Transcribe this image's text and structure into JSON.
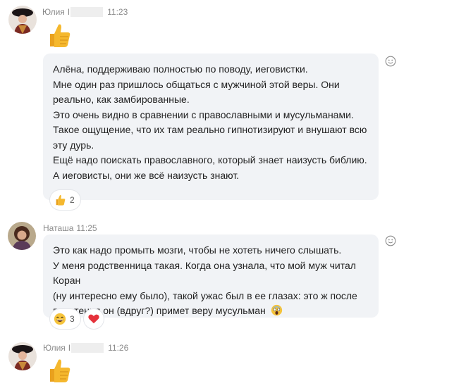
{
  "messages": [
    {
      "author": "Юлия",
      "author_suffix": "I",
      "time": "11:23",
      "content_type": "thumbs-up-emoji"
    },
    {
      "author": "Юлия",
      "lines": [
        "Алёна, поддерживаю полностью по поводу, иеговистки.",
        "Мне один раз пришлось общаться с мужчиной этой веры. Они",
        "реально, как замбированные.",
        "Это очень видно в сравнении с православными и мусульманами.",
        "Такое ощущение, что их там реально гипнотизируют и внушают всю",
        "эту дурь.",
        "Ещё надо поискать православного, который знает наизусть библию.",
        "А иеговисты, они же всё наизусть знают."
      ],
      "reactions": [
        {
          "icon": "thumbs-up-icon",
          "count": "2"
        }
      ]
    },
    {
      "author": "Наташа",
      "time": "11:25",
      "lines": [
        "Это как надо промыть мозги, чтобы не хотеть ничего слышать.",
        "У меня родственница такая. Когда она узнала, что мой муж читал Коран",
        "(ну интересно ему было), такой ужас был в ее глазах: это ж после",
        "прочтения он (вдруг?) примет веру мусульман"
      ],
      "inline_emoji": "screaming-face-icon",
      "reactions": [
        {
          "icon": "laughing-face-icon",
          "count": "3"
        },
        {
          "icon": "heart-icon",
          "count": ""
        }
      ]
    },
    {
      "author": "Юлия",
      "author_suffix": "I",
      "time": "11:26",
      "content_type": "thumbs-up-emoji"
    }
  ],
  "colors": {
    "bubble": "#f1f3f6",
    "meta_text": "#8a8a8a",
    "thumb": "#f5b82e",
    "heart": "#e5323b"
  }
}
